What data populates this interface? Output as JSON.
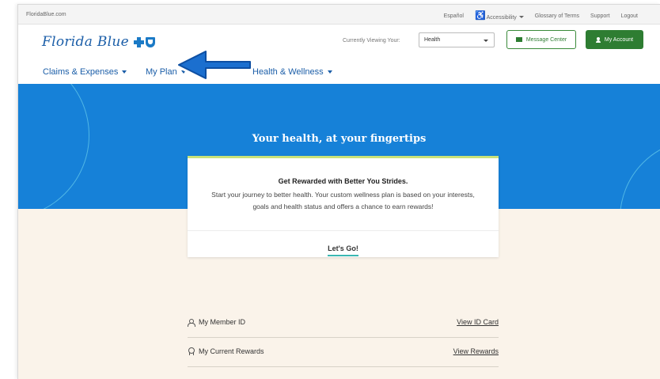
{
  "utility_bar": {
    "site": "FloridaBlue.com",
    "espanol": "Español",
    "accessibility": "Accessibility",
    "glossary": "Glossary of Terms",
    "support": "Support",
    "logout": "Logout"
  },
  "header": {
    "logo_text": "Florida Blue",
    "viewing_label": "Currently Viewing Your:",
    "viewing_value": "Health",
    "message_center": "Message Center",
    "my_account": "My Account"
  },
  "nav": {
    "items": [
      {
        "label": "Claims & Expenses"
      },
      {
        "label": "My Plan"
      },
      {
        "label": "Health & Wellness"
      }
    ]
  },
  "hero": {
    "title": "Your health, at your fingertips"
  },
  "card": {
    "title": "Get Rewarded with Better You Strides.",
    "body": "Start your journey to better health. Your custom wellness plan is based on your interests, goals and health status and offers a chance to earn rewards!",
    "cta": "Let's Go!"
  },
  "rows": [
    {
      "label": "My Member ID",
      "link": "View ID Card",
      "icon": "person-icon"
    },
    {
      "label": "My Current Rewards",
      "link": "View Rewards",
      "icon": "ribbon-icon"
    }
  ],
  "colors": {
    "brand_blue": "#1b5ea8",
    "hero_blue": "#1681d8",
    "green": "#2e7d32",
    "beige": "#faf3ea",
    "accent_teal": "#3bb8b2"
  }
}
